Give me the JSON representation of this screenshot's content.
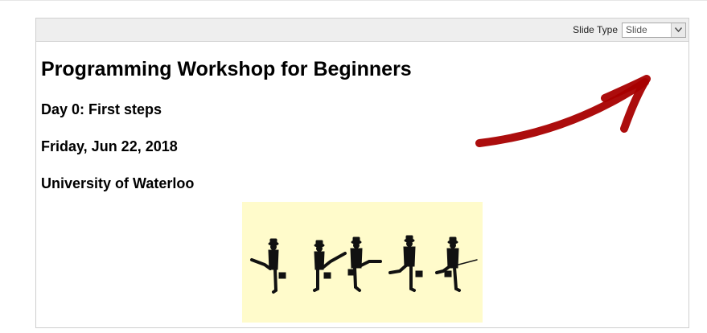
{
  "toolbar": {
    "slide_type_label": "Slide Type",
    "slide_type_value": "Slide"
  },
  "slide": {
    "title": "Programming Workshop for Beginners",
    "day": "Day 0: First steps",
    "date": "Friday, Jun 22, 2018",
    "institution": "University of Waterloo"
  },
  "icons": {
    "dropdown": "chevron-down-icon",
    "annotation": "hand-drawn-arrow"
  },
  "colors": {
    "annotation_arrow": "#a80000",
    "image_background": "#fffbcb"
  }
}
